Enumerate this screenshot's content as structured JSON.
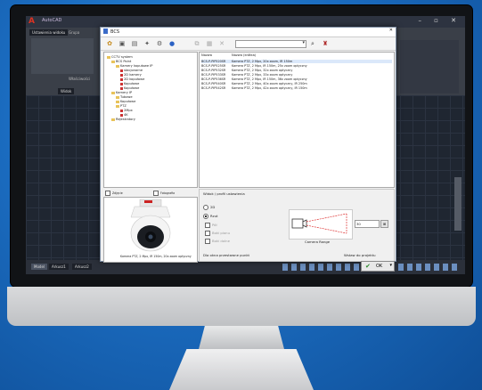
{
  "cad": {
    "title": "AutoCAD",
    "panel_label": "Ustawienia widoku",
    "group_label": "Grupa",
    "palette_label": "Właściwości",
    "view_label": "Widok",
    "window_controls": "– ▫ ✕",
    "layout_tabs": [
      "Model",
      "Arkusz1",
      "Arkusz2"
    ],
    "axis_x": "X",
    "axis_y": "Y"
  },
  "dialog": {
    "title": "BCS",
    "close": "✕",
    "toolbar_icons": [
      "gear-icon",
      "open-icon",
      "save-icon",
      "pin-icon",
      "settings-icon",
      "info-icon",
      "copy-icon",
      "paste-icon",
      "delete-icon",
      "search-icon",
      "find-icon"
    ],
    "search_combo_value": "",
    "tree": [
      {
        "label": "CCTV system",
        "level": 0,
        "kind": "folder"
      },
      {
        "label": "BCS Point",
        "level": 1,
        "kind": "folder"
      },
      {
        "label": "Kamery kopułowe IP",
        "level": 2,
        "kind": "folder"
      },
      {
        "label": "stacjonarne",
        "level": 3,
        "kind": "cam"
      },
      {
        "label": "2D kamery",
        "level": 3,
        "kind": "cam"
      },
      {
        "label": "2D kopułowe",
        "level": 3,
        "kind": "cam"
      },
      {
        "label": "Kopułowe",
        "level": 3,
        "kind": "cam"
      },
      {
        "label": "Kopułowe",
        "level": 3,
        "kind": "cam"
      },
      {
        "label": "Kamery IP",
        "level": 1,
        "kind": "folder"
      },
      {
        "label": "Tubowe",
        "level": 2,
        "kind": "folder"
      },
      {
        "label": "Kopułowe",
        "level": 2,
        "kind": "folder"
      },
      {
        "label": "PTZ",
        "level": 2,
        "kind": "folder"
      },
      {
        "label": "2Mpx",
        "level": 3,
        "kind": "cam"
      },
      {
        "label": "4K",
        "level": 3,
        "kind": "cam"
      },
      {
        "label": "Rejestratory",
        "level": 1,
        "kind": "folder"
      }
    ],
    "list_headers": {
      "name": "Nazwa",
      "desc": "Nazwa (krótka)"
    },
    "list_rows": [
      {
        "name": "BCS-P-PIP520SR",
        "desc": "Kamera PTZ, 2 Mpx, 20x zoom, IR 150m"
      },
      {
        "name": "BCS-P-PIP525SR",
        "desc": "Kamera PTZ, 2 Mpx, IR 150m, 25x zoom optyczny"
      },
      {
        "name": "BCS-P-PIP532SR",
        "desc": "Kamera PTZ, 2 Mpx, 32x zoom optyczny"
      },
      {
        "name": "BCS-P-PIP533SR",
        "desc": "Kamera PTZ, 2 Mpx, 33x zoom optyczny"
      },
      {
        "name": "BCS-P-PIP536SR",
        "desc": "Kamera PTZ, 2 Mpx, IR 150m, 36x zoom optyczny"
      },
      {
        "name": "BCS-P-PIP540SR",
        "desc": "Kamera PTZ, 2 Mpx, 40x zoom optyczny, IR 250m"
      },
      {
        "name": "BCS-P-PIP542SR",
        "desc": "Kamera PTZ, 2 Mpx, 42x zoom optyczny, IR 150m"
      }
    ],
    "preview_tabs": {
      "left": "Zdjęcie",
      "right": "Fotografia"
    },
    "preview_caption": "Kamera PTZ, 2 Mpx, IR 150m, 20x zoom optyczny",
    "options": {
      "group_label": "Widok / profil ustawienia",
      "radio_2d": "2D",
      "radio_rzut": "Rzut",
      "check_1": "Pół",
      "check_2": "Boki pionu",
      "check_3": "Boki dolne",
      "range_label": "Camera Range",
      "range_value": "30",
      "insert_label": "Wstaw do projektu",
      "insert_point": "Dla okna przestawne punkt"
    },
    "ok_label": "OK"
  }
}
